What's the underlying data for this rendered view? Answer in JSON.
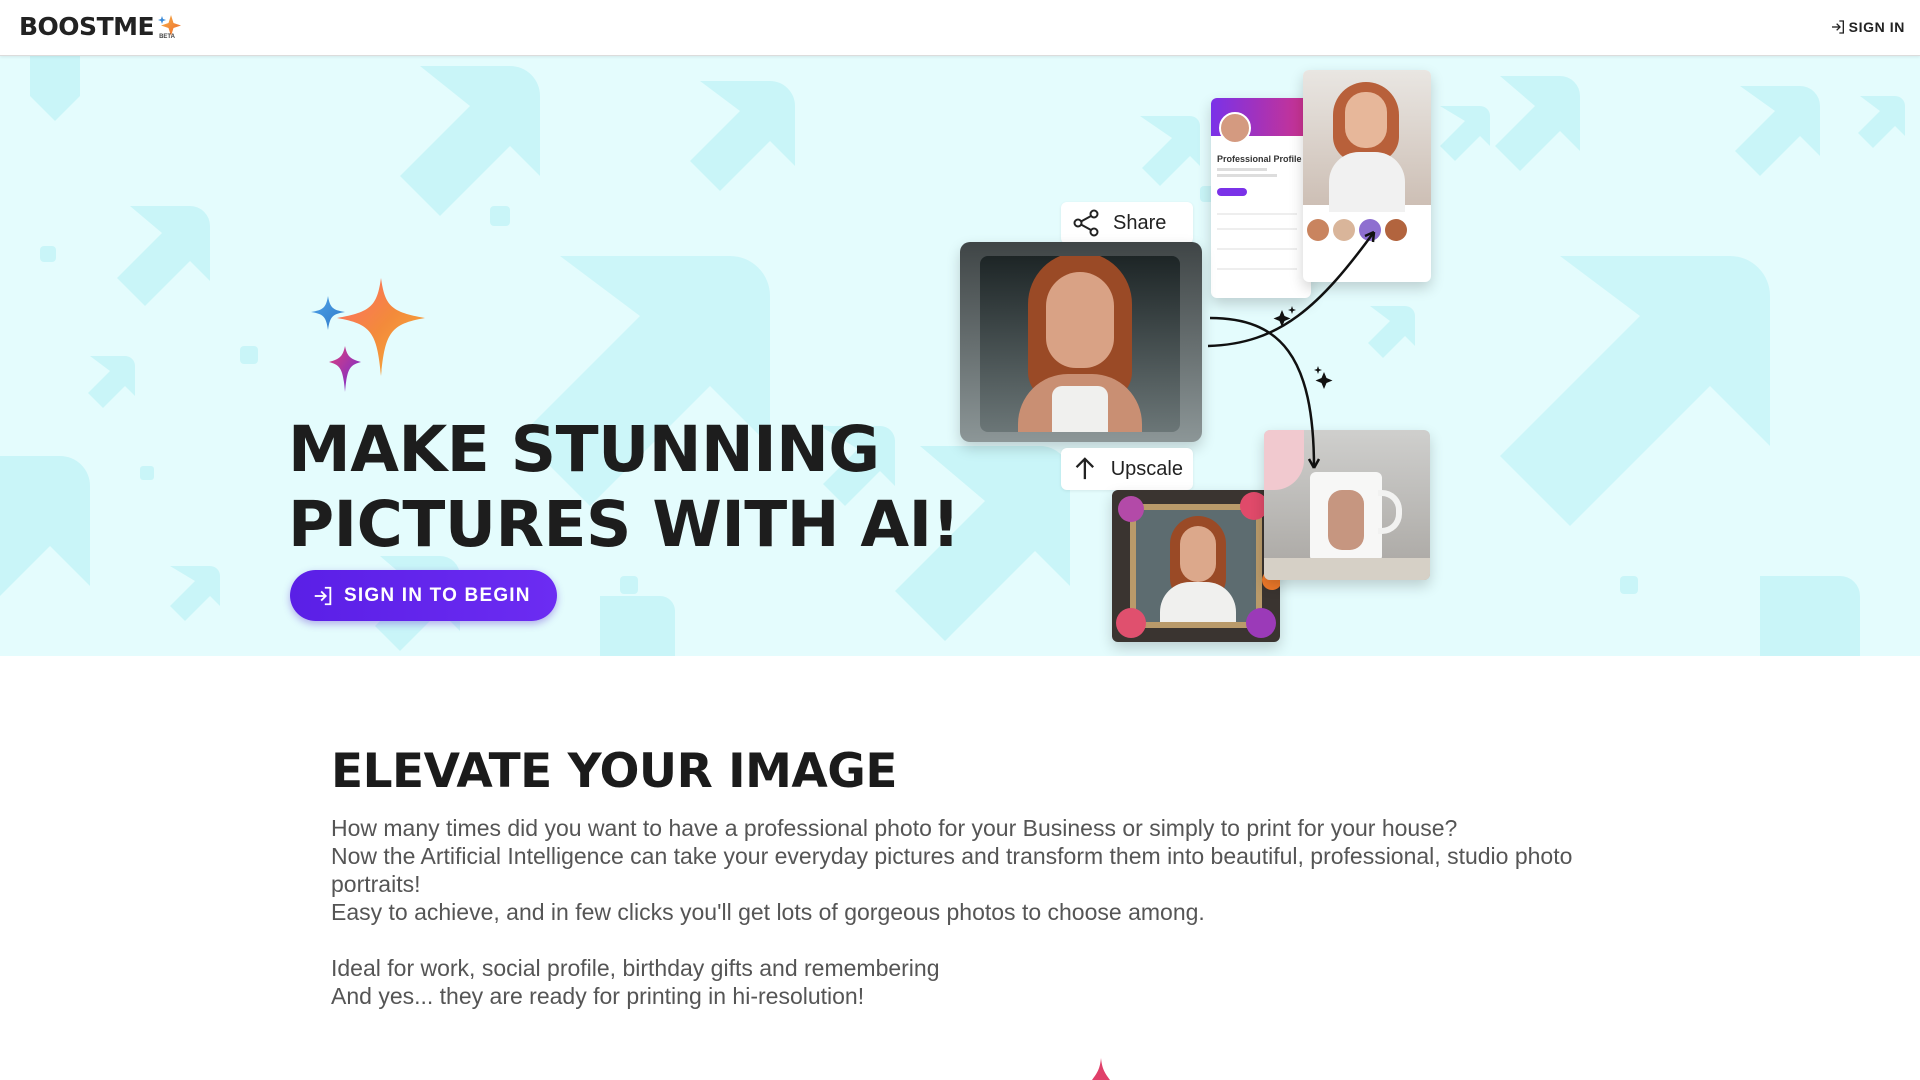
{
  "header": {
    "logo_text": "BOOSTME",
    "logo_badge": "BETA",
    "signin_label": "SIGN IN",
    "signin_icon": "login-icon"
  },
  "hero": {
    "headline_line1": "MAKE STUNNING",
    "headline_line2": "PICTURES WITH AI!",
    "cta_label": "SIGN IN TO BEGIN",
    "cta_icon": "login-icon",
    "share_label": "Share",
    "upscale_label": "Upscale",
    "profile_card_title": "Professional Profile",
    "carousel": {
      "count": 4,
      "active_index": 2
    },
    "colors": {
      "background": "#e4fcfd",
      "accent": "#5a1fe6",
      "shape": "#c8f6f9"
    }
  },
  "section": {
    "title": "ELEVATE YOUR IMAGE",
    "paragraphs": [
      "How many times did you want to have a professional photo for your Business or simply to print for your house?",
      "Now the Artificial Intelligence can take your everyday pictures and transform them into beautiful, professional, studio photo portraits!",
      "Easy to achieve, and in few clicks you'll get lots of gorgeous photos to choose among.",
      "",
      "Ideal for work, social profile, birthday gifts and remembering",
      "And yes... they are ready for printing in hi-resolution!"
    ]
  }
}
